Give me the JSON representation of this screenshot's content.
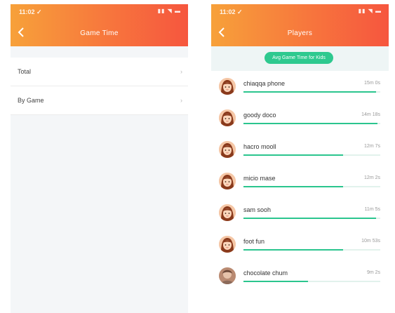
{
  "colors": {
    "header_gradient_start": "#f7a13a",
    "header_gradient_end": "#f6563e",
    "accent_green": "#2bc58e",
    "page_background": "#f4f6f8"
  },
  "left_screen": {
    "status_bar": {
      "time": "11:02 ✓",
      "icons": "▮▮ ◥ ▬"
    },
    "header": {
      "back_icon": "chevron-left-icon",
      "title": "Game Time"
    },
    "menu": [
      {
        "label": "Total",
        "chevron": "›"
      },
      {
        "label": "By Game",
        "chevron": "›"
      }
    ]
  },
  "right_screen": {
    "status_bar": {
      "time": "11:02 ✓",
      "icons": "▮▮ ◥ ▬"
    },
    "header": {
      "back_icon": "chevron-left-icon",
      "title": "Players"
    },
    "filter_button": "Avg Game Time for Kids",
    "players": [
      {
        "name": "chiaqqa phone",
        "value": "15m 0s",
        "progress": 0.97,
        "avatar": "girl-avatar"
      },
      {
        "name": "goody doco",
        "value": "14m 18s",
        "progress": 0.98,
        "avatar": "girl-avatar"
      },
      {
        "name": "hacro mooll",
        "value": "12m 7s",
        "progress": 0.73,
        "avatar": "girl-avatar"
      },
      {
        "name": "micio mase",
        "value": "12m 2s",
        "progress": 0.73,
        "avatar": "girl-avatar"
      },
      {
        "name": "sam sooh",
        "value": "11m 5s",
        "progress": 0.97,
        "avatar": "girl-avatar"
      },
      {
        "name": "foot fun",
        "value": "10m 53s",
        "progress": 0.73,
        "avatar": "girl-avatar"
      },
      {
        "name": "chocolate chum",
        "value": "9m 2s",
        "progress": 0.47,
        "avatar": "photo-avatar"
      }
    ]
  }
}
